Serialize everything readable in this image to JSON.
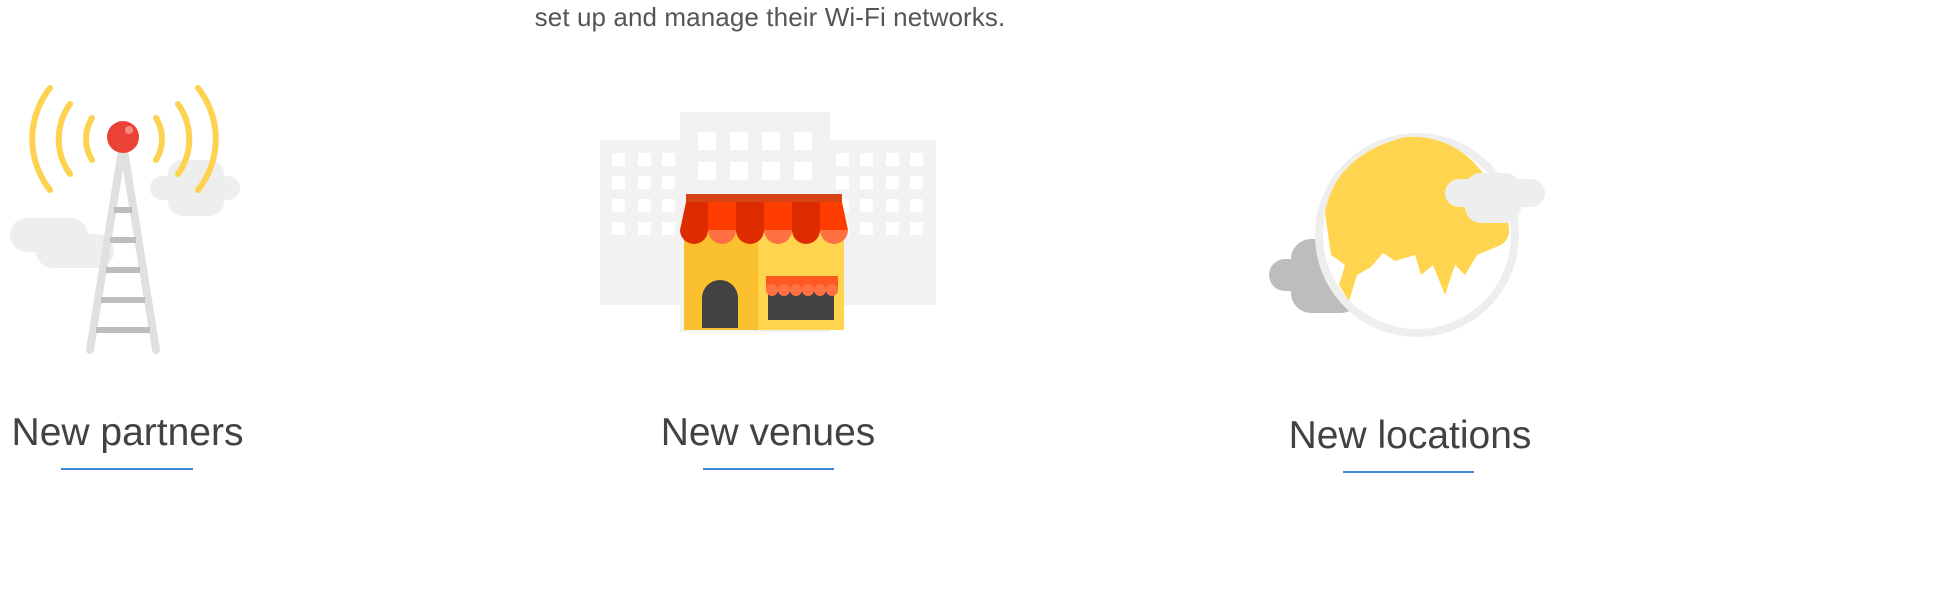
{
  "intro": {
    "text": "set up and manage their Wi-Fi networks."
  },
  "features": [
    {
      "title": "New partners",
      "illustration": "radio-tower-icon"
    },
    {
      "title": "New venues",
      "illustration": "storefront-icon"
    },
    {
      "title": "New locations",
      "illustration": "globe-icon"
    }
  ],
  "colors": {
    "accent_underline": "#3f87d8",
    "heading_text": "#424242",
    "yellow": "#fdd24f",
    "red": "#ea4335",
    "orange": "#ff5722",
    "light_gray": "#eeeeee"
  }
}
